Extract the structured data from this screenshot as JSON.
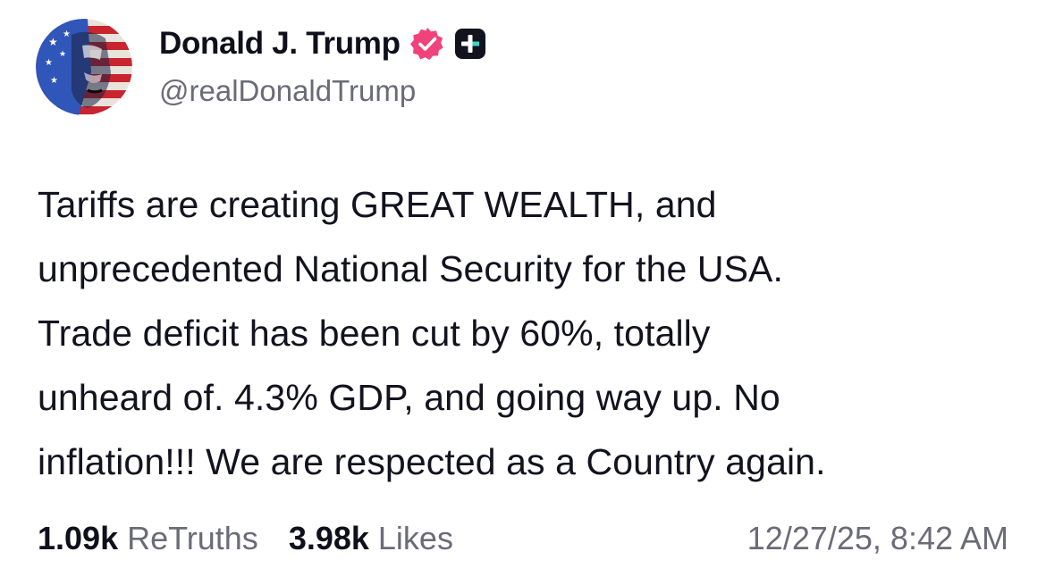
{
  "author": {
    "display_name": "Donald J. Trump",
    "handle": "@realDonaldTrump",
    "avatar_icon": "profile-avatar",
    "verified_icon": "verified-badge-icon",
    "subscription_icon": "plus-icon",
    "verified_color": "#f0437b"
  },
  "post": {
    "lines": [
      "Tariffs are creating GREAT WEALTH, and",
      "unprecedented National Security for the USA.",
      "Trade deficit has been cut by 60%, totally",
      "unheard of. 4.3% GDP, and going way up. No",
      "inflation!!! We are respected as a Country again."
    ]
  },
  "stats": {
    "retruths_count": "1.09k",
    "retruths_label": "ReTruths",
    "likes_count": "3.98k",
    "likes_label": "Likes",
    "timestamp": "12/27/25, 8:42 AM"
  }
}
